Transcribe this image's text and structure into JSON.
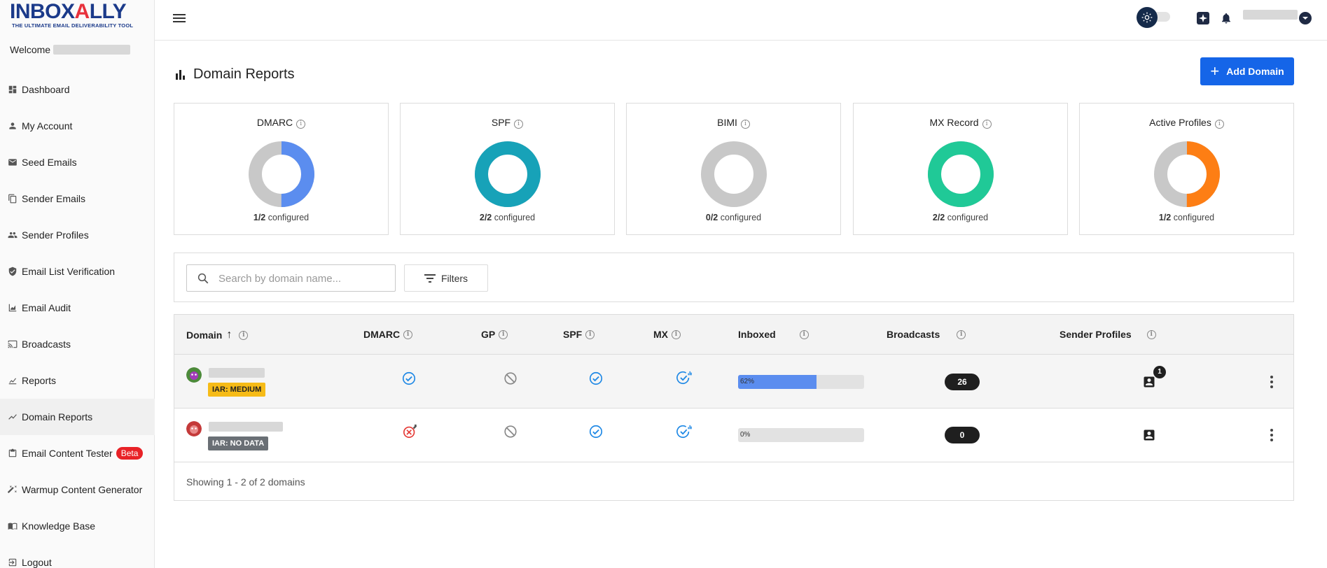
{
  "brand": {
    "logo_text": "INBOXALLY",
    "tagline": "THE ULTIMATE EMAIL DELIVERABILITY TOOL"
  },
  "sidebar": {
    "welcome_label": "Welcome",
    "items": [
      {
        "label": "Dashboard",
        "icon": "dashboard-icon"
      },
      {
        "label": "My Account",
        "icon": "person-icon"
      },
      {
        "label": "Seed Emails",
        "icon": "mail-icon"
      },
      {
        "label": "Sender Emails",
        "icon": "copy-icon"
      },
      {
        "label": "Sender Profiles",
        "icon": "people-icon"
      },
      {
        "label": "Email List Verification",
        "icon": "shield-check-icon"
      },
      {
        "label": "Email Audit",
        "icon": "chart-area-icon"
      },
      {
        "label": "Broadcasts",
        "icon": "broadcast-icon"
      },
      {
        "label": "Reports",
        "icon": "chart-line-icon"
      },
      {
        "label": "Domain Reports",
        "icon": "trend-icon"
      },
      {
        "label": "Email Content Tester",
        "icon": "clipboard-icon",
        "badge": "Beta"
      },
      {
        "label": "Warmup Content Generator",
        "icon": "wand-icon"
      },
      {
        "label": "Knowledge Base",
        "icon": "book-icon"
      },
      {
        "label": "Logout",
        "icon": "logout-icon"
      }
    ],
    "active_item": "Domain Reports"
  },
  "header": {
    "page_title": "Domain Reports",
    "add_button_label": "Add Domain"
  },
  "cards": [
    {
      "title": "DMARC",
      "configured": "1/2",
      "suffix": "configured",
      "fraction": 0.5,
      "color": "#5b8def"
    },
    {
      "title": "SPF",
      "configured": "2/2",
      "suffix": "configured",
      "fraction": 1.0,
      "color": "#17a2b8"
    },
    {
      "title": "BIMI",
      "configured": "0/2",
      "suffix": "configured",
      "fraction": 0.0,
      "color": "#c8c8c8"
    },
    {
      "title": "MX Record",
      "configured": "2/2",
      "suffix": "configured",
      "fraction": 1.0,
      "color": "#20c997"
    },
    {
      "title": "Active Profiles",
      "configured": "1/2",
      "suffix": "configured",
      "fraction": 0.5,
      "color": "#fd7e14"
    }
  ],
  "search": {
    "placeholder": "Search by domain name...",
    "filters_label": "Filters"
  },
  "table": {
    "columns": [
      "Domain",
      "DMARC",
      "GP",
      "SPF",
      "MX",
      "Inboxed",
      "Broadcasts",
      "Sender Profiles"
    ],
    "rows": [
      {
        "iar": "IAR: MEDIUM",
        "dmarc": "check",
        "gp": "blocked",
        "spf": "check",
        "mx": "check-signal",
        "inboxed": 0.62,
        "inboxed_label": "62%",
        "broadcasts": "26",
        "profiles_badge": "1"
      },
      {
        "iar": "IAR: NO DATA",
        "dmarc": "error-wrench",
        "gp": "blocked",
        "spf": "check",
        "mx": "check-signal",
        "inboxed": 0.0,
        "inboxed_label": "0%",
        "broadcasts": "0",
        "profiles_badge": ""
      }
    ],
    "footer": "Showing 1 - 2 of 2 domains"
  },
  "colors": {
    "primary": "#1565e8",
    "check_blue": "#1e88e5",
    "error_red": "#e53935",
    "iar_medium": "#f6bb17",
    "iar_nodata": "#6a6f75"
  }
}
